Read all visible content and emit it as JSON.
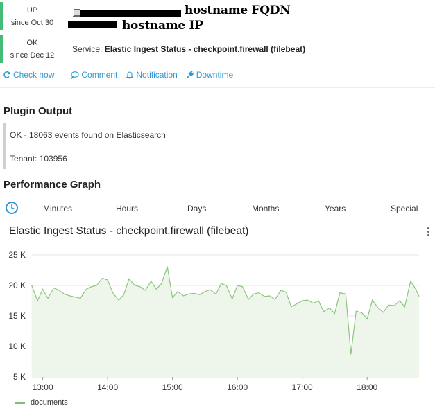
{
  "host": {
    "state": "UP",
    "since": "since Oct 30",
    "fqdn_redaction_label": "hostname FQDN",
    "ip_redaction_label": "hostname IP"
  },
  "service": {
    "state": "OK",
    "since": "since Dec 12",
    "prefix": "Service:",
    "name": "Elastic Ingest Status - checkpoint.firewall (filebeat)"
  },
  "actions": {
    "check_now": "Check now",
    "comment": "Comment",
    "notification": "Notification",
    "downtime": "Downtime"
  },
  "plugin_output": {
    "title": "Plugin Output",
    "line1": "OK - 18063 events found on Elasticsearch",
    "line2": "Tenant: 103956"
  },
  "performance": {
    "title": "Performance Graph",
    "ranges": [
      "Minutes",
      "Hours",
      "Days",
      "Months",
      "Years",
      "Special"
    ]
  },
  "colors": {
    "ok_green": "#44bb77",
    "link_blue": "#2e9ad1",
    "series_line": "#8cc57e",
    "series_fill": "#eef6ec"
  },
  "chart_data": {
    "type": "area",
    "title": "Elastic Ingest Status - checkpoint.firewall (filebeat)",
    "xlabel": "",
    "ylabel": "",
    "ylim": [
      5000,
      25000
    ],
    "yticks": [
      5000,
      10000,
      15000,
      20000,
      25000
    ],
    "ytick_labels": [
      "5 K",
      "10 K",
      "15 K",
      "20 K",
      "25 K"
    ],
    "xlim": [
      12.833,
      13.8
    ],
    "xticks": [
      13.0,
      14.0,
      15.0,
      16.0,
      17.0,
      18.0
    ],
    "xtick_labels": [
      "13:00",
      "14:00",
      "15:00",
      "16:00",
      "17:00",
      "18:00"
    ],
    "x_domain_hours": [
      12.833,
      18.8
    ],
    "grid": "horizontal",
    "legend": "bottom-left",
    "series": [
      {
        "name": "documents",
        "x": [
          12.83,
          12.92,
          13.0,
          13.08,
          13.17,
          13.25,
          13.33,
          13.42,
          13.5,
          13.58,
          13.67,
          13.75,
          13.83,
          13.92,
          14.0,
          14.08,
          14.17,
          14.25,
          14.33,
          14.42,
          14.5,
          14.58,
          14.67,
          14.75,
          14.83,
          14.92,
          15.0,
          15.08,
          15.17,
          15.25,
          15.33,
          15.42,
          15.5,
          15.58,
          15.67,
          15.75,
          15.83,
          15.92,
          16.0,
          16.08,
          16.17,
          16.25,
          16.33,
          16.42,
          16.5,
          16.58,
          16.67,
          16.75,
          16.83,
          16.92,
          17.0,
          17.08,
          17.17,
          17.25,
          17.33,
          17.42,
          17.5,
          17.58,
          17.67,
          17.75,
          17.83,
          17.92,
          18.0,
          18.08,
          18.17,
          18.25,
          18.33,
          18.42,
          18.5,
          18.58,
          18.67,
          18.75,
          18.8
        ],
        "values": [
          20000,
          17500,
          19400,
          17900,
          19600,
          19200,
          18600,
          18300,
          18100,
          17900,
          19400,
          19800,
          20000,
          21200,
          20900,
          18800,
          17600,
          18500,
          21100,
          20000,
          19800,
          19200,
          20700,
          19400,
          20300,
          23100,
          18000,
          19000,
          18300,
          18600,
          18700,
          18500,
          19000,
          19300,
          18600,
          20300,
          20000,
          17800,
          20000,
          19800,
          17700,
          18600,
          18800,
          18200,
          18300,
          17700,
          19200,
          18900,
          16500,
          17000,
          17500,
          17600,
          17100,
          17500,
          15700,
          16300,
          15400,
          18800,
          18600,
          8700,
          15800,
          15500,
          14500,
          17600,
          16300,
          15600,
          16800,
          16700,
          17500,
          16500,
          20700,
          19400,
          18200
        ]
      }
    ]
  }
}
